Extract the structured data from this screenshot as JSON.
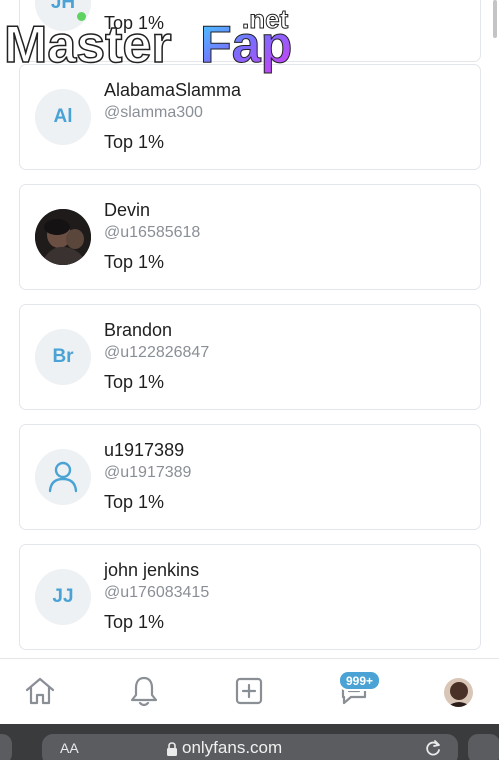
{
  "watermark": {
    "part1": "Master",
    "part2": "Fap",
    "part3": ".net"
  },
  "top_partial": {
    "initials": "JH",
    "rank": "Top 1%"
  },
  "fans": [
    {
      "name": "AlabamaSlamma",
      "handle": "@slamma300",
      "rank": "Top 1%",
      "initials": "Al",
      "avatar": "initials"
    },
    {
      "name": "Devin",
      "handle": "@u16585618",
      "rank": "Top 1%",
      "initials": "",
      "avatar": "photo"
    },
    {
      "name": "Brandon",
      "handle": "@u122826847",
      "rank": "Top 1%",
      "initials": "Br",
      "avatar": "initials"
    },
    {
      "name": "u1917389",
      "handle": "@u1917389",
      "rank": "Top 1%",
      "initials": "",
      "avatar": "user-icon"
    },
    {
      "name": "john jenkins",
      "handle": "@u176083415",
      "rank": "Top 1%",
      "initials": "JJ",
      "avatar": "initials"
    }
  ],
  "nav": {
    "items": [
      "home-icon",
      "bell-icon",
      "plus-square-icon",
      "messages-icon",
      "profile-avatar"
    ],
    "messages_badge": "999+"
  },
  "browser": {
    "url": "onlyfans.com",
    "aa": "AA"
  },
  "colors": {
    "accent": "#4aa3d4",
    "online": "#5fd35f",
    "card_border": "#e3e6ea",
    "browser_bg": "#3a3b3d"
  }
}
